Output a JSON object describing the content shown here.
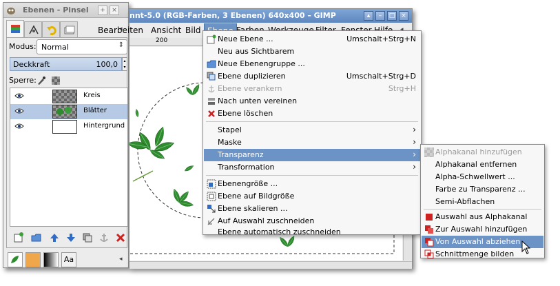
{
  "dock": {
    "title": "Ebenen - Pinsel",
    "mode_label": "Modus:",
    "mode_value": "Normal",
    "opacity_label": "Deckkraft",
    "opacity_value": "100,0",
    "lock_label": "Sperre:",
    "layers": [
      {
        "name": "Kreis",
        "selected": false
      },
      {
        "name": "Blätter",
        "selected": true
      },
      {
        "name": "Hintergrund",
        "selected": false
      }
    ]
  },
  "main": {
    "title": "nnt-5.0 (RGB-Farben, 3 Ebenen) 640x400 – GIMP",
    "menubar": [
      "Bearbeiten",
      "Ansicht",
      "Bild",
      "Ebene",
      "Farben",
      "Werkzeuge",
      "Filter",
      "Fenster",
      "Hilfe"
    ],
    "ruler_mark": "200"
  },
  "layer_menu": {
    "items": [
      {
        "label": "Neue Ebene ...",
        "shortcut": "Umschalt+Strg+N",
        "icon": "new-layer-icon"
      },
      {
        "label": "Neu aus Sichtbarem",
        "shortcut": "",
        "icon": ""
      },
      {
        "label": "Neue Ebenengruppe ...",
        "shortcut": "",
        "icon": "folder-icon"
      },
      {
        "label": "Ebene duplizieren",
        "shortcut": "Umschalt+Strg+D",
        "icon": "duplicate-icon"
      },
      {
        "label": "Ebene verankern",
        "shortcut": "Strg+H",
        "icon": "anchor-icon",
        "disabled": true
      },
      {
        "label": "Nach unten vereinen",
        "shortcut": "",
        "icon": "merge-down-icon"
      },
      {
        "label": "Ebene löschen",
        "shortcut": "",
        "icon": "delete-icon"
      },
      {
        "label": "Stapel",
        "submenu": true
      },
      {
        "label": "Maske",
        "submenu": true
      },
      {
        "label": "Transparenz",
        "submenu": true,
        "highlighted": true
      },
      {
        "label": "Transformation",
        "submenu": true
      },
      {
        "label": "Ebenengröße ...",
        "shortcut": "",
        "icon": "layer-size-icon"
      },
      {
        "label": "Ebene auf Bildgröße",
        "shortcut": "",
        "icon": "layer-to-image-icon"
      },
      {
        "label": "Ebene skalieren ...",
        "shortcut": "",
        "icon": "scale-icon"
      },
      {
        "label": "Auf Auswahl zuschneiden",
        "shortcut": "",
        "icon": "crop-icon"
      },
      {
        "label": "Ebene automatisch zuschneiden",
        "shortcut": "",
        "icon": ""
      }
    ]
  },
  "transparency_menu": {
    "items": [
      {
        "label": "Alphakanal hinzufügen",
        "icon": "add-alpha-icon",
        "disabled": true
      },
      {
        "label": "Alphakanal entfernen",
        "icon": ""
      },
      {
        "label": "Alpha-Schwellwert ...",
        "icon": ""
      },
      {
        "label": "Farbe zu Transparenz ...",
        "icon": ""
      },
      {
        "label": "Semi-Abflachen",
        "icon": ""
      },
      {
        "label": "Auswahl aus Alphakanal",
        "icon": "selection-replace-icon"
      },
      {
        "label": "Zur Auswahl hinzufügen",
        "icon": "selection-add-icon"
      },
      {
        "label": "Von Auswahl abziehen",
        "icon": "selection-subtract-icon",
        "highlighted": true
      },
      {
        "label": "Schnittmenge bilden",
        "icon": "selection-intersect-icon"
      }
    ]
  },
  "colors": {
    "highlight": "#6c93c6",
    "leaf_green": "#2e8b2e",
    "delete_red": "#cc2222"
  }
}
